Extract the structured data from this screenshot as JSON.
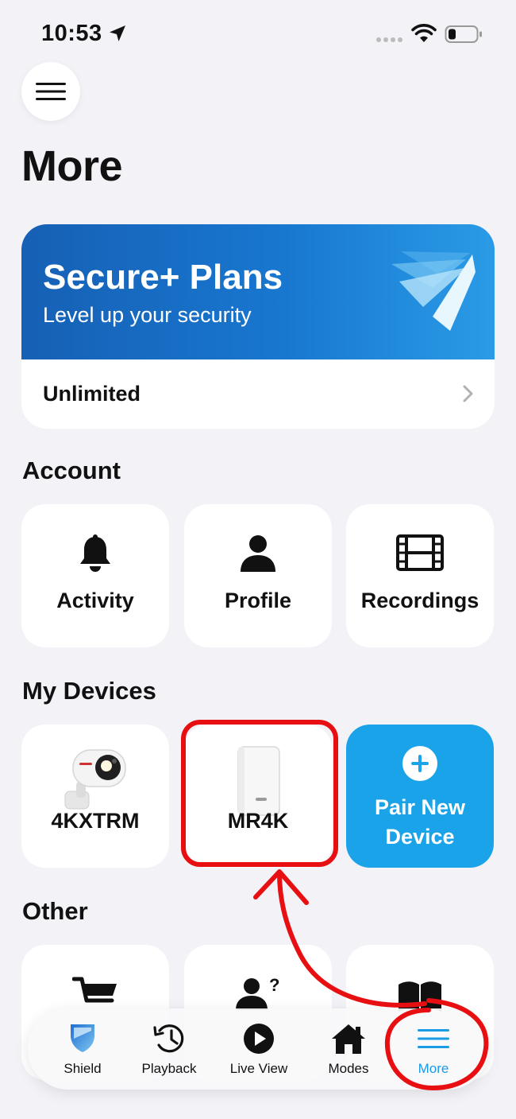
{
  "status_bar": {
    "time": "10:53"
  },
  "page": {
    "title": "More"
  },
  "plans_card": {
    "title": "Secure+ Plans",
    "subtitle": "Level up your security",
    "plan_name": "Unlimited"
  },
  "account": {
    "title": "Account",
    "items": [
      {
        "label": "Activity",
        "icon": "bell-icon"
      },
      {
        "label": "Profile",
        "icon": "person-icon"
      },
      {
        "label": "Recordings",
        "icon": "film-icon"
      }
    ]
  },
  "devices": {
    "title": "My Devices",
    "items": [
      {
        "label": "4KXTRM",
        "icon": "spotlight-camera-icon"
      },
      {
        "label": "MR4K",
        "icon": "recorder-hub-icon"
      }
    ],
    "pair_label_line1": "Pair New",
    "pair_label_line2": "Device"
  },
  "other": {
    "title": "Other"
  },
  "tabbar": {
    "tabs": [
      {
        "label": "Shield",
        "icon": "shield-icon",
        "active": false
      },
      {
        "label": "Playback",
        "icon": "history-icon",
        "active": false
      },
      {
        "label": "Live View",
        "icon": "play-circle-icon",
        "active": false
      },
      {
        "label": "Modes",
        "icon": "house-icon",
        "active": false
      },
      {
        "label": "More",
        "icon": "menu-lines-icon",
        "active": true
      }
    ]
  },
  "colors": {
    "accent": "#1a9be6",
    "banner_blue": "#1660b5",
    "annotation_red": "#e80f12",
    "background": "#f2f2f7"
  }
}
